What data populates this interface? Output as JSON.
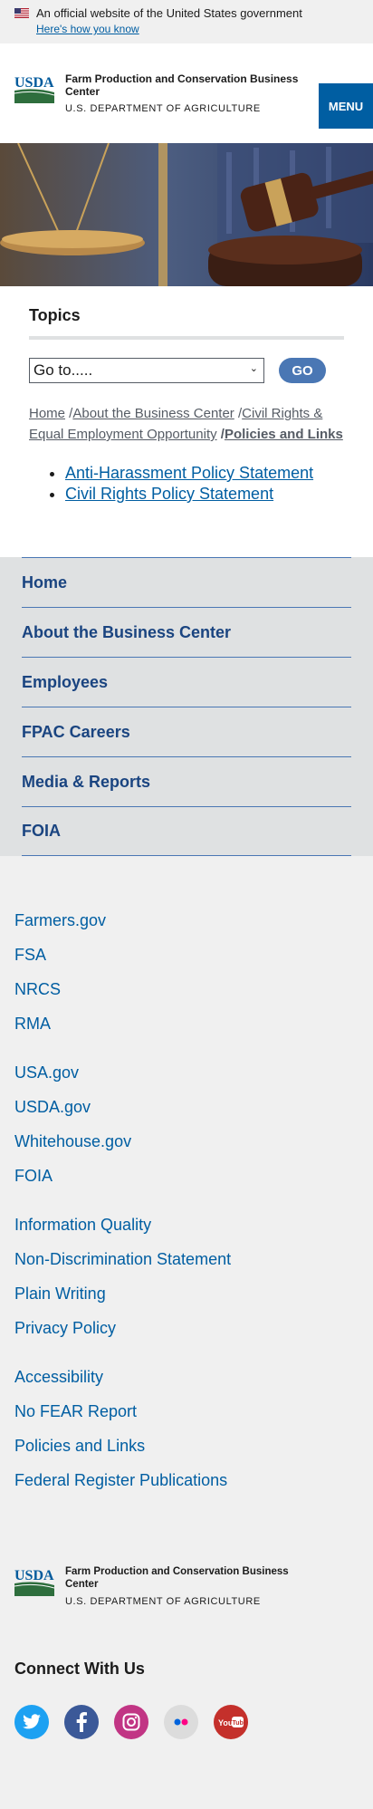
{
  "gov_banner": {
    "text": "An official website of the United States government",
    "link": "Here's how you know"
  },
  "header": {
    "agency_name": "Farm Production and Conservation Business Center",
    "department": "U.S. DEPARTMENT OF AGRICULTURE",
    "menu_label": "MENU",
    "logo_text": "USDA"
  },
  "topics": {
    "title": "Topics",
    "select_value": "Go to.....",
    "go_label": "GO"
  },
  "breadcrumb": {
    "home": "Home",
    "sep1": " /",
    "about": "About the Business Center",
    "sep2": " /",
    "civil": "Civil Rights & Equal Employment Opportunity",
    "sep3": " /",
    "current": "Policies and Links"
  },
  "policy_links": [
    "Anti-Harassment Policy Statement",
    "Civil Rights Policy Statement"
  ],
  "sidenav": [
    "Home",
    "About the Business Center",
    "Employees",
    "FPAC Careers",
    "Media & Reports",
    "FOIA"
  ],
  "footer_links": {
    "group1": [
      "Farmers.gov",
      "FSA",
      "NRCS",
      "RMA"
    ],
    "group2": [
      "USA.gov",
      "USDA.gov",
      "Whitehouse.gov",
      "FOIA"
    ],
    "group3": [
      "Information Quality",
      "Non-Discrimination Statement",
      "Plain Writing",
      "Privacy Policy"
    ],
    "group4": [
      "Accessibility",
      "No FEAR Report",
      "Policies and Links",
      "Federal Register Publications"
    ]
  },
  "footer": {
    "agency_name": "Farm Production and Conservation Business Center",
    "department": "U.S. DEPARTMENT OF AGRICULTURE",
    "connect_title": "Connect With Us",
    "socials": [
      {
        "icon": "twitter-icon",
        "color": "#1da1f2"
      },
      {
        "icon": "facebook-icon",
        "color": "#3b5998"
      },
      {
        "icon": "instagram-icon",
        "color": "#c13584"
      },
      {
        "icon": "flickr-icon",
        "color": "#dcdcdc"
      },
      {
        "icon": "youtube-icon",
        "color": "#c4302b"
      }
    ]
  },
  "colors": {
    "link": "#005ea2",
    "nav_text": "#1a4480",
    "go_button": "#4a77b4",
    "usda_green": "#2e6e3d"
  }
}
